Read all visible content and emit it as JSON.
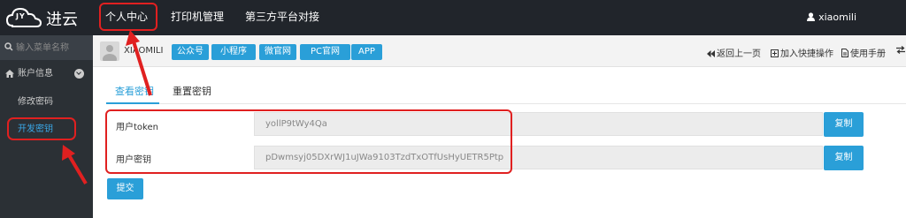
{
  "brand": {
    "logo_jy": "JY",
    "logo_text": "进云"
  },
  "topnav": {
    "items": [
      "个人中心",
      "打印机管理",
      "第三方平台对接"
    ],
    "user": "xiaomili"
  },
  "sidebar": {
    "search_placeholder": "输入菜单名称",
    "group_label": "账户信息",
    "items": [
      "修改密码",
      "开发密钥"
    ]
  },
  "subbar": {
    "account": "XIAOMILI",
    "pills": [
      "公众号",
      "小程序",
      "微官网",
      "PC官网",
      "APP"
    ],
    "tools": [
      "返回上一页",
      "加入快捷操作",
      "使用手册"
    ]
  },
  "tabs": [
    "查看密钥",
    "重置密钥"
  ],
  "form": {
    "token_label": "用户token",
    "token_value": "yollP9tWy4Qa",
    "key_label": "用户密钥",
    "key_value": "pDwmsyj05DXrWJ1uJWa9103TzdTxOTfUsHyUETR5Ptp",
    "copy_label": "复制",
    "submit_label": "提交"
  },
  "colors": {
    "topbar": "#21252b",
    "sidebar": "#2b3035",
    "accent": "#2a9fd8",
    "annotation": "#e02020"
  }
}
